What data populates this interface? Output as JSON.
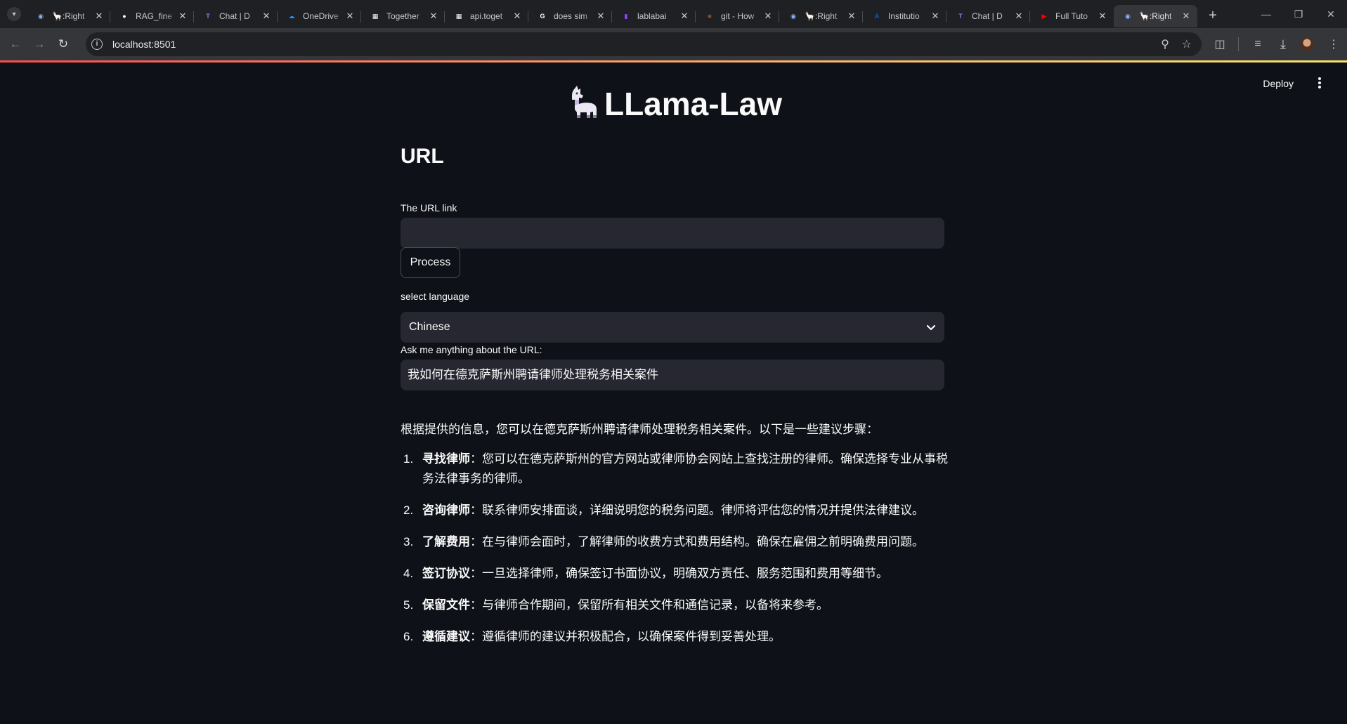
{
  "browser": {
    "tabs": [
      {
        "title": "🦙:Right",
        "icon": "robot-icon",
        "color": "#8ab4f8"
      },
      {
        "title": "RAG_fine",
        "icon": "github-icon",
        "color": "#ffffff"
      },
      {
        "title": "Chat | D",
        "icon": "teams-icon",
        "color": "#7b83eb"
      },
      {
        "title": "OneDrive",
        "icon": "cloud-icon",
        "color": "#1e90ff"
      },
      {
        "title": "Together",
        "icon": "page-icon",
        "color": "#ffffff"
      },
      {
        "title": "api.toget",
        "icon": "page-icon",
        "color": "#ffffff"
      },
      {
        "title": "does sim",
        "icon": "google-icon",
        "color": "#ffffff"
      },
      {
        "title": "lablabai",
        "icon": "twitch-icon",
        "color": "#9146ff"
      },
      {
        "title": "git - How",
        "icon": "stackoverflow-icon",
        "color": "#f48024"
      },
      {
        "title": "🦙:Right",
        "icon": "robot-icon",
        "color": "#8ab4f8"
      },
      {
        "title": "Institutio",
        "icon": "a-icon",
        "color": "#0b57d0"
      },
      {
        "title": "Chat | D",
        "icon": "teams-icon",
        "color": "#7b83eb"
      },
      {
        "title": "Full Tuto",
        "icon": "youtube-icon",
        "color": "#ff0000"
      },
      {
        "title": "🦙:Right",
        "icon": "robot-icon",
        "color": "#8ab4f8"
      }
    ],
    "active_tab_index": 13,
    "url": "localhost:8501"
  },
  "app": {
    "deploy_label": "Deploy",
    "title_emoji": "🦙",
    "title": "LLama-Law",
    "section_heading": "URL",
    "url_label": "The URL link",
    "url_value": "",
    "process_label": "Process",
    "language_label": "select language",
    "language_value": "Chinese",
    "question_label": "Ask me anything about the URL:",
    "question_value": "我如何在德克萨斯州聘请律师处理税务相关案件",
    "answer_intro": "根据提供的信息，您可以在德克萨斯州聘请律师处理税务相关案件。以下是一些建议步骤：",
    "steps": [
      {
        "num": "1.",
        "title": "寻找律师",
        "text": "：您可以在德克萨斯州的官方网站或律师协会网站上查找注册的律师。确保选择专业从事税务法律事务的律师。"
      },
      {
        "num": "2.",
        "title": "咨询律师",
        "text": "：联系律师安排面谈，详细说明您的税务问题。律师将评估您的情况并提供法律建议。"
      },
      {
        "num": "3.",
        "title": "了解费用",
        "text": "：在与律师会面时，了解律师的收费方式和费用结构。确保在雇佣之前明确费用问题。"
      },
      {
        "num": "4.",
        "title": "签订协议",
        "text": "：一旦选择律师，确保签订书面协议，明确双方责任、服务范围和费用等细节。"
      },
      {
        "num": "5.",
        "title": "保留文件",
        "text": "：与律师合作期间，保留所有相关文件和通信记录，以备将来参考。"
      },
      {
        "num": "6.",
        "title": "遵循建议",
        "text": "：遵循律师的建议并积极配合，以确保案件得到妥善处理。"
      }
    ]
  }
}
